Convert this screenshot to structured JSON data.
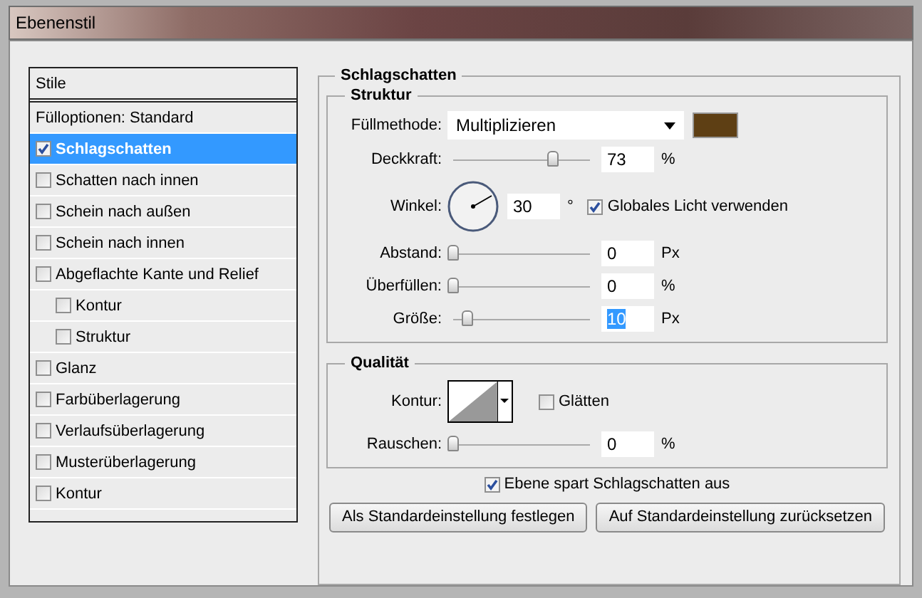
{
  "window": {
    "title": "Ebenenstil"
  },
  "styles": {
    "header": "Stile",
    "items": [
      {
        "kind": "plain",
        "label": "Fülloptionen: Standard",
        "selected": false
      },
      {
        "kind": "check",
        "label": "Schlagschatten",
        "checked": true,
        "selected": true
      },
      {
        "kind": "check",
        "label": "Schatten nach innen",
        "checked": false,
        "selected": false
      },
      {
        "kind": "check",
        "label": "Schein nach außen",
        "checked": false,
        "selected": false
      },
      {
        "kind": "check",
        "label": "Schein nach innen",
        "checked": false,
        "selected": false
      },
      {
        "kind": "check",
        "label": "Abgeflachte Kante und Relief",
        "checked": false,
        "selected": false,
        "children": [
          {
            "kind": "check",
            "label": "Kontur",
            "checked": false,
            "selected": false
          },
          {
            "kind": "check",
            "label": "Struktur",
            "checked": false,
            "selected": false
          }
        ]
      },
      {
        "kind": "check",
        "label": "Glanz",
        "checked": false,
        "selected": false
      },
      {
        "kind": "check",
        "label": "Farbüberlagerung",
        "checked": false,
        "selected": false
      },
      {
        "kind": "check",
        "label": "Verlaufsüberlagerung",
        "checked": false,
        "selected": false
      },
      {
        "kind": "check",
        "label": "Musterüberlagerung",
        "checked": false,
        "selected": false
      },
      {
        "kind": "check",
        "label": "Kontur",
        "checked": false,
        "selected": false
      }
    ]
  },
  "panel": {
    "title": "Schlagschatten",
    "structure": {
      "title": "Struktur",
      "rows": [
        {
          "kind": "select",
          "label": "Füllmethode:",
          "value": "Multiplizieren",
          "color": "#5e3f14"
        },
        {
          "kind": "slider",
          "label": "Deckkraft:",
          "level": 0.73,
          "value": "73",
          "unit": "%",
          "focused": false
        },
        {
          "kind": "angle",
          "label": "Winkel:",
          "value": "30",
          "unit": "°",
          "check_label": "Globales Licht verwenden",
          "checked": true
        },
        {
          "kind": "slider",
          "label": "Abstand:",
          "level": 0,
          "value": "0",
          "unit": "Px",
          "focused": false
        },
        {
          "kind": "slider",
          "label": "Überfüllen:",
          "level": 0,
          "value": "0",
          "unit": "%",
          "focused": false
        },
        {
          "kind": "slider",
          "label": "Größe:",
          "level": 0.1,
          "value": "10",
          "unit": "Px",
          "focused": true
        }
      ]
    },
    "quality": {
      "title": "Qualität",
      "rows": [
        {
          "kind": "contour",
          "label": "Kontur:",
          "check_label": "Glätten",
          "checked": false
        },
        {
          "kind": "slider",
          "label": "Rauschen:",
          "level": 0,
          "value": "0",
          "unit": "%",
          "focused": false
        }
      ]
    },
    "knockout": {
      "label": "Ebene spart Schlagschatten aus",
      "checked": true
    },
    "buttons": [
      "Als Standardeinstellung festlegen",
      "Auf Standardeinstellung zurücksetzen"
    ]
  }
}
